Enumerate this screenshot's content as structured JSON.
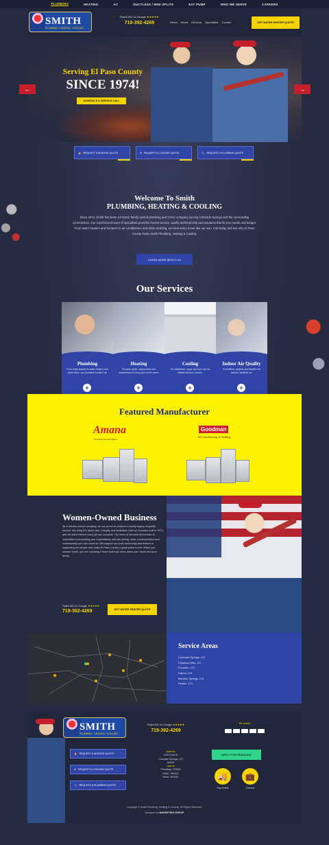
{
  "top_nav": [
    {
      "label": "PLUMBING",
      "active": true
    },
    {
      "label": "HEATING"
    },
    {
      "label": "AC"
    },
    {
      "label": "DUCTLESS / MINI SPLITS"
    },
    {
      "label": "EAT PUMP"
    },
    {
      "label": "WHO WE SERVE"
    },
    {
      "label": "CAREERS"
    }
  ],
  "header": {
    "logo_name": "SMITH",
    "phone_label": "Rated 5/5 On Google",
    "phone": "719-392-4269",
    "links": [
      "Home",
      "About",
      "Reviews",
      "Specialists",
      "Contact"
    ],
    "cta": "GET WATER HEATER QUOTE"
  },
  "hero": {
    "serving": "Serving El Paso County",
    "since": "SINCE 1974!",
    "button": "SCHEDULE A SERVICE CALL",
    "prev_arrow": "←",
    "next_arrow": "→"
  },
  "quote_buttons": [
    {
      "icon": "flame-icon",
      "glyph": "🔥",
      "label": "REQUEST A HEATING QUOTE"
    },
    {
      "icon": "snowflake-icon",
      "glyph": "❄",
      "label": "REQUEST A COOLING QUOTE"
    },
    {
      "icon": "wrench-icon",
      "glyph": "🔧",
      "label": "REQUEST A PLUMBING QUOTE"
    }
  ],
  "welcome": {
    "title1": "Welcome To Smith",
    "title2": "PLUMBING, HEATING & COOLING",
    "body": "Since 1974, Smith has been a trusted, family-owned plumbing and HVAC company serving Colorado Springs and the surrounding communities. Our experienced team of specialists provides honest service, quality workmanship and solutions that fit your needs and budget. From water heaters and furnaces to air conditioners and drain cleaning, we treat every home like our own. Call today and see why El Paso County trusts Smith Plumbing, Heating & Cooling.",
    "button": "LEARN MORE ABOUT US"
  },
  "services": {
    "title": "Our Services",
    "items": [
      {
        "title": "Plumbing",
        "desc": "From leaky faucets to water heaters and sewer lines, our plumbers handle it all."
      },
      {
        "title": "Heating",
        "desc": "Furnace repair, replacement and maintenance to keep your home warm."
      },
      {
        "title": "Cooling",
        "desc": "AC installation, repair and tune-ups for reliable summer comfort."
      },
      {
        "title": "Indoor Air Quality",
        "desc": "Humidifiers, purifiers and filtration for cleaner, healthier air."
      }
    ]
  },
  "featured": {
    "title": "Featured Manufacturer",
    "amana": "Amana",
    "amana_tag": "America's Favorite Brand",
    "goodman": "Goodman",
    "goodman_tag": "Air Conditioning & Heating"
  },
  "women": {
    "title": "Women-Owned Business",
    "body": "As a woman-owned company, we are proud to continue a family legacy of quality service. We bring the same care, integrity and dedication that our founders built in 1974, and we stand behind every job we complete. Our team of licensed technicians is committed to exceeding your expectations with fair pricing, clear communication and workmanship you can count on. We support our local community and believe in supporting the people who make El Paso County a great place to live. When you choose Smith, you are choosing a team that truly cares about your home and your family.",
    "phone_label": "Rated 5/5 On Google",
    "phone": "719-392-4269",
    "cta": "GET WATER HEATER QUOTE"
  },
  "areas": {
    "title": "Service Areas",
    "list": [
      "Colorado Springs, CO",
      "Cimarron Hills, CO",
      "Fountain, CO",
      "Falcon, CO",
      "Manitou Springs, CO",
      "Peyton, CO"
    ]
  },
  "footer": {
    "buttons": [
      {
        "icon": "flame-icon",
        "glyph": "🔥",
        "label": "REQUEST A HEATING QUOTE"
      },
      {
        "icon": "snowflake-icon",
        "glyph": "❄",
        "label": "REQUEST A COOLING QUOTE"
      },
      {
        "icon": "wrench-icon",
        "glyph": "🔧",
        "label": "REQUEST A PLUMBING QUOTE"
      }
    ],
    "phone_label": "Rated 5/5 On Google",
    "phone": "719-392-4269",
    "address_header": "Address",
    "address": [
      "1125 Ford St",
      "Colorado Springs, CO",
      "80915"
    ],
    "license_header": "License",
    "license": [
      "Plumbing: 123456",
      "HVAC: 654321",
      "Mech: 987654"
    ],
    "pay_header": "We Accept",
    "apply": "APPLY FOR FINANCING",
    "icon_labels": [
      "Pay Online",
      "Careers"
    ],
    "copyright": "Copyright © Smith Plumbing, Heating & Cooling. All Rights Reserved.",
    "powered_prefix": "Designed by",
    "powered_brand": "MARKETING GROUP"
  },
  "colors": {
    "accent_yellow": "#f6d400",
    "brand_blue": "#2e44a7",
    "brand_red": "#c41f2b",
    "bg_navy": "#262a3f"
  }
}
